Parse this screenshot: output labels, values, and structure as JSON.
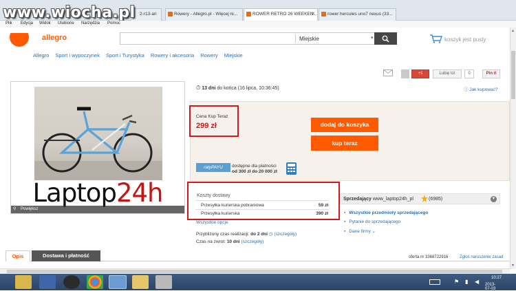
{
  "watermark": "www.wiocha.pl",
  "browser": {
    "tabs": [
      {
        "label": "2-r13-ari"
      },
      {
        "label": "Rowery - Allegro.pl - Więcej ni..."
      },
      {
        "label": "ROWER RETRO 26 WEEKEN..."
      },
      {
        "label": "rower hercules uno7 nexus (33..."
      }
    ],
    "menu": [
      "Plik",
      "Edycja",
      "Widok",
      "Ulubione",
      "Narzędzia",
      "Pomoc"
    ]
  },
  "header": {
    "brand": "allegro",
    "search_value": "",
    "category": "Miejskie",
    "cart_label": "koszyk jest pusty"
  },
  "nav": [
    "Allegro",
    "Sport i wypoczynek",
    "Sport i Turystyka",
    "Rowery i akcesoria",
    "Rowery",
    "Miejskie"
  ],
  "social": {
    "gplus": "+1",
    "like": "Lubię to!",
    "like_count": "0",
    "pin": "Pin it"
  },
  "gallery": {
    "brand_text_black": "Laptop",
    "brand_text_red": "24h",
    "zoom_label": "Powiększ"
  },
  "auction": {
    "days": "13 dni",
    "ends": "do końca (16 lipca, 10:36:45)",
    "ask": "Jak kupować?"
  },
  "buy": {
    "price_label": "Cena Kup Teraz",
    "price": "299 zł",
    "add_cart": "dodaj do koszyka",
    "buy_now": "kup teraz",
    "raty": "ratyPAYU",
    "pay_line1": "dostępne dla płatności",
    "pay_line2": "od 300 zł do 20 000 zł"
  },
  "delivery": {
    "title": "Koszty dostawy",
    "rows": [
      {
        "name": "Przesyłka kurierska pobraniowa",
        "price": "59 zł"
      },
      {
        "name": "Przesyłka kurierska",
        "price": "390 zł"
      }
    ],
    "all_options": "Wszystkie opcje",
    "realization_label": "Przybliżony czas realizacji:",
    "realization_value": "do 2 dni",
    "return_label": "Czas na zwrot:",
    "return_value": "10 dni",
    "details": "(szczegóły)"
  },
  "seller": {
    "label": "Sprzedający",
    "name": "www_laptop24h_pl",
    "rating": "(6985)",
    "links": [
      "Wszystkie przedmioty sprzedającego",
      "Pytanie do sprzedającego",
      "Dane firmy"
    ]
  },
  "bottom_tabs": [
    "Opis",
    "Dostawa i płatność"
  ],
  "offer_nr": "oferta nr 3368722916",
  "report": "Zgłoś naruszenie zasad",
  "tray": {
    "time": "10:27",
    "date": "2013-07-03"
  },
  "colors": {
    "accent": "#ff5a00",
    "price": "#d3171c",
    "link": "#2a6fb1",
    "highlight_box": "#d3171c"
  }
}
